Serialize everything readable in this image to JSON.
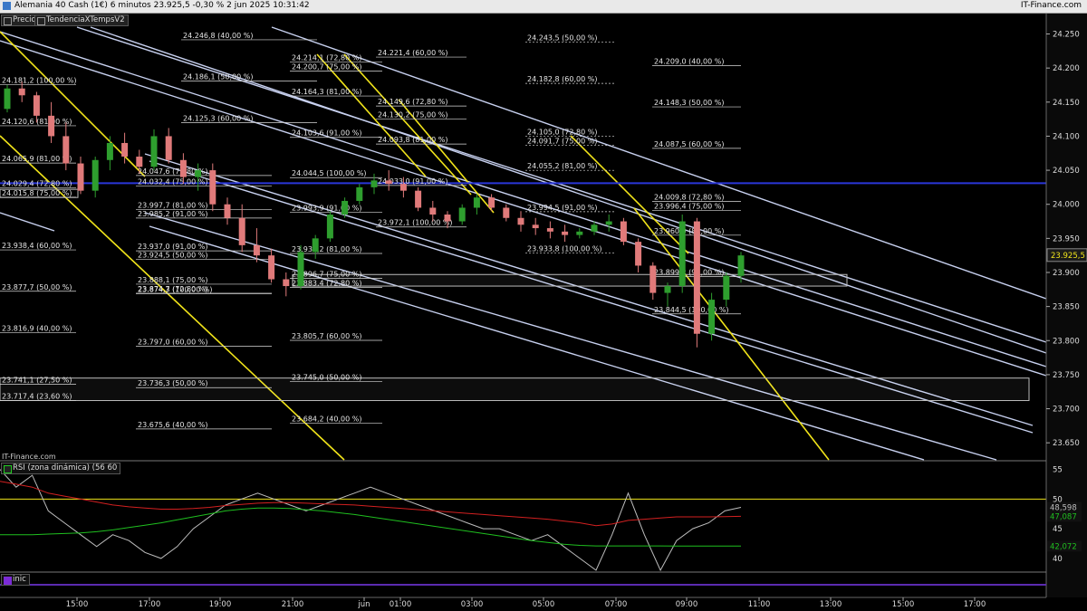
{
  "window": {
    "title": "Alemania 40 Cash (1€) 6 minutos 23.925,5 -0,30 % 2 jun 2025 10:31:42",
    "brand": "IT-Finance.com"
  },
  "legend": {
    "items": [
      "Precio",
      "TendenciaXTempsV2"
    ]
  },
  "watermark": "IT-Finance.com",
  "rsi_legend": "RSI (zona dinámica) (56 60",
  "inic_legend": "inic",
  "colors": {
    "background": "#000000",
    "candle_up": "#2e9e2e",
    "candle_down": "#e07a7a",
    "trend_white": "#c7d0ef",
    "trend_yellow": "#f1e41a",
    "horizontal_blue": "#2a36d9",
    "rsi_line": "#bdbdbd",
    "rsi_red": "#d32020",
    "rsi_green": "#1fbf1f"
  },
  "chart_data": [
    {
      "type": "candlestick",
      "title": "Alemania 40 Cash (1€) 6 minutos",
      "y_ticks": [
        "24.250",
        "24.200",
        "24.150",
        "24.100",
        "24.050",
        "24.000",
        "23.950",
        "23.900",
        "23.850",
        "23.800",
        "23.750",
        "23.700",
        "23.650"
      ],
      "x_ticks": [
        "15:00",
        "17:00",
        "19:00",
        "21:00",
        "jun",
        "01:00",
        "03:00",
        "05:00",
        "07:00",
        "09:00",
        "11:00",
        "13:00",
        "15:00",
        "17:00"
      ],
      "ylim": [
        23625,
        24260
      ],
      "last_price_label": "23.925,5",
      "horizontal_line": 24031,
      "fib_levels": [
        {
          "label": "24.246,8 (40,00 %)",
          "value": 24246.8
        },
        {
          "label": "24.186,1 (50,00 %)",
          "value": 24186.1
        },
        {
          "label": "24.125,3 (60,00 %)",
          "value": 24125.3
        },
        {
          "label": "24.047,6 (72,80 %)",
          "value": 24047.6
        },
        {
          "label": "24.032,4 (75,00 %)",
          "value": 24032.4
        },
        {
          "label": "23.997,7 (81,00 %)",
          "value": 23997.7
        },
        {
          "label": "23.985,2 (91,00 %)",
          "value": 23985.2
        },
        {
          "label": "23.937,0 (91,00 %)",
          "value": 23937.0
        },
        {
          "label": "23.924,5 (50,00 %)",
          "value": 23924.5
        },
        {
          "label": "23.888,1 (75,00 %)",
          "value": 23888.1
        },
        {
          "label": "23.874,7 (72,80 %)",
          "value": 23874.7
        },
        {
          "label": "23.874,3 (100,00 %)",
          "value": 23874.3
        },
        {
          "label": "23.797,0 (60,00 %)",
          "value": 23797.0
        },
        {
          "label": "23.736,3 (50,00 %)",
          "value": 23736.3
        },
        {
          "label": "23.675,6 (40,00 %)",
          "value": 23675.6
        },
        {
          "label": "24.181,2 (100,00 %)",
          "value": 24181.2
        },
        {
          "label": "24.120,6 (81,00 %)",
          "value": 24120.6
        },
        {
          "label": "24.065,9 (81,00 %)",
          "value": 24065.9
        },
        {
          "label": "24.029,4 (72,80 %)",
          "value": 24029.4
        },
        {
          "label": "24.015,8 (75,00 %)",
          "value": 24015.8
        },
        {
          "label": "23.938,4 (60,00 %)",
          "value": 23938.4
        },
        {
          "label": "23.877,7 (50,00 %)",
          "value": 23877.7
        },
        {
          "label": "23.816,9 (40,00 %)",
          "value": 23816.9
        },
        {
          "label": "23.741,1 (27,50 %)",
          "value": 23741.1
        },
        {
          "label": "23.717,4 (23,60 %)",
          "value": 23717.4
        },
        {
          "label": "24.214,1 (72,80 %)",
          "value": 24214.1
        },
        {
          "label": "24.200,7 (75,00 %)",
          "value": 24200.7
        },
        {
          "label": "24.164,3 (81,00 %)",
          "value": 24164.3
        },
        {
          "label": "24.103,6 (91,00 %)",
          "value": 24103.6
        },
        {
          "label": "24.044,5 (100,00 %)",
          "value": 24044.5
        },
        {
          "label": "23.993,9 (91,00 %)",
          "value": 23993.9
        },
        {
          "label": "23.933,2 (81,00 %)",
          "value": 23933.2
        },
        {
          "label": "23.896,7 (75,00 %)",
          "value": 23896.7
        },
        {
          "label": "23.883,4 (72,80 %)",
          "value": 23883.4
        },
        {
          "label": "23.805,7 (60,00 %)",
          "value": 23805.7
        },
        {
          "label": "23.745,0 (50,00 %)",
          "value": 23745.0
        },
        {
          "label": "23.684,2 (40,00 %)",
          "value": 23684.2
        },
        {
          "label": "24.221,4 (60,00 %)",
          "value": 24221.4
        },
        {
          "label": "24.149,6 (72,80 %)",
          "value": 24149.6
        },
        {
          "label": "24.130,2 (75,00 %)",
          "value": 24130.2
        },
        {
          "label": "24.093,8 (81,00 %)",
          "value": 24093.8
        },
        {
          "label": "24.033,0 (91,00 %)",
          "value": 24033.0
        },
        {
          "label": "23.972,1 (100,00 %)",
          "value": 23972.1
        },
        {
          "label": "24.243,5 (50,00 %)",
          "value": 24243.5
        },
        {
          "label": "24.182,8 (60,00 %)",
          "value": 24182.8
        },
        {
          "label": "24.105,0 (72,80 %)",
          "value": 24105.0
        },
        {
          "label": "24.091,7 (75,00 %)",
          "value": 24091.7
        },
        {
          "label": "24.055,2 (81,00 %)",
          "value": 24055.2
        },
        {
          "label": "23.994,5 (91,00 %)",
          "value": 23994.5
        },
        {
          "label": "23.933,8 (100,00 %)",
          "value": 23933.8
        },
        {
          "label": "24.209,0 (40,00 %)",
          "value": 24209.0
        },
        {
          "label": "24.148,3 (50,00 %)",
          "value": 24148.3
        },
        {
          "label": "24.087,5 (60,00 %)",
          "value": 24087.5
        },
        {
          "label": "24.009,8 (72,80 %)",
          "value": 24009.8
        },
        {
          "label": "23.996,4 (75,00 %)",
          "value": 23996.4
        },
        {
          "label": "23.960,0 (81,00 %)",
          "value": 23960.0
        },
        {
          "label": "23.899,2 (91,00 %)",
          "value": 23899.2
        },
        {
          "label": "23.844,5 (100,00 %)",
          "value": 23844.5
        }
      ],
      "candles": [
        [
          24140,
          24175,
          24135,
          24170
        ],
        [
          24170,
          24180,
          24150,
          24160
        ],
        [
          24160,
          24165,
          24120,
          24130
        ],
        [
          24130,
          24150,
          24090,
          24100
        ],
        [
          24100,
          24120,
          24050,
          24060
        ],
        [
          24060,
          24070,
          24015,
          24020
        ],
        [
          24020,
          24070,
          24010,
          24065
        ],
        [
          24065,
          24100,
          24050,
          24090
        ],
        [
          24090,
          24105,
          24060,
          24070
        ],
        [
          24070,
          24080,
          24045,
          24055
        ],
        [
          24055,
          24110,
          24050,
          24100
        ],
        [
          24100,
          24112,
          24060,
          24065
        ],
        [
          24065,
          24075,
          24030,
          24040
        ],
        [
          24040,
          24060,
          24020,
          24050
        ],
        [
          24050,
          24060,
          23990,
          24000
        ],
        [
          24000,
          24010,
          23970,
          23980
        ],
        [
          23980,
          24000,
          23930,
          23940
        ],
        [
          23940,
          23965,
          23915,
          23925
        ],
        [
          23925,
          23935,
          23885,
          23890
        ],
        [
          23890,
          23900,
          23865,
          23880
        ],
        [
          23880,
          23940,
          23875,
          23930
        ],
        [
          23930,
          23955,
          23920,
          23950
        ],
        [
          23950,
          23990,
          23945,
          23985
        ],
        [
          23985,
          24010,
          23980,
          24005
        ],
        [
          24005,
          24030,
          24000,
          24025
        ],
        [
          24025,
          24045,
          24015,
          24035
        ],
        [
          24035,
          24050,
          24020,
          24030
        ],
        [
          24030,
          24040,
          24010,
          24020
        ],
        [
          24020,
          24025,
          23990,
          23995
        ],
        [
          23995,
          24005,
          23975,
          23985
        ],
        [
          23985,
          23990,
          23965,
          23975
        ],
        [
          23975,
          24000,
          23970,
          23995
        ],
        [
          23995,
          24015,
          23985,
          24010
        ],
        [
          24010,
          24015,
          23990,
          23995
        ],
        [
          23995,
          24000,
          23975,
          23980
        ],
        [
          23980,
          23990,
          23960,
          23970
        ],
        [
          23970,
          23980,
          23955,
          23965
        ],
        [
          23965,
          23975,
          23950,
          23960
        ],
        [
          23960,
          23970,
          23945,
          23955
        ],
        [
          23955,
          23965,
          23950,
          23960
        ],
        [
          23960,
          23975,
          23955,
          23970
        ],
        [
          23970,
          23985,
          23960,
          23975
        ],
        [
          23975,
          23980,
          23940,
          23945
        ],
        [
          23945,
          23950,
          23900,
          23910
        ],
        [
          23910,
          23915,
          23860,
          23870
        ],
        [
          23870,
          23885,
          23850,
          23880
        ],
        [
          23880,
          23985,
          23870,
          23975
        ],
        [
          23975,
          23980,
          23790,
          23810
        ],
        [
          23810,
          23870,
          23800,
          23860
        ],
        [
          23860,
          23900,
          23850,
          23895
        ],
        [
          23895,
          23930,
          23885,
          23925
        ]
      ]
    },
    {
      "type": "line",
      "title": "RSI (zona dinámica) (56 60",
      "y_ticks": [
        "55",
        "50",
        "45",
        "40"
      ],
      "ylim": [
        38,
        56
      ],
      "reference_line": 50,
      "value_labels": [
        "48,598",
        "47,087",
        "42,072"
      ],
      "series": [
        {
          "name": "RSI",
          "values": [
            55,
            52,
            54,
            48,
            46,
            44,
            42,
            44,
            43,
            41,
            40,
            42,
            45,
            47,
            49,
            50,
            51,
            50,
            49,
            48,
            49,
            50,
            51,
            52,
            51,
            50,
            49,
            48,
            47,
            46,
            45,
            45,
            44,
            43,
            44,
            42,
            40,
            38,
            44,
            51,
            44,
            38,
            43,
            45,
            46,
            48,
            48.6
          ]
        },
        {
          "name": "upper",
          "values": [
            53,
            52.5,
            52,
            51,
            50.5,
            50,
            49.5,
            49,
            48.7,
            48.5,
            48.3,
            48.3,
            48.4,
            48.6,
            48.9,
            49.1,
            49.3,
            49.4,
            49.4,
            49.3,
            49.2,
            49.1,
            49.0,
            48.8,
            48.6,
            48.4,
            48.2,
            48.0,
            47.8,
            47.6,
            47.4,
            47.2,
            47.0,
            46.8,
            46.6,
            46.3,
            46.0,
            45.5,
            45.8,
            46.4,
            46.6,
            46.8,
            47.0,
            47.0,
            47.0,
            47.05,
            47.087
          ]
        },
        {
          "name": "lower",
          "values": [
            44,
            44,
            44,
            44.1,
            44.2,
            44.3,
            44.5,
            44.8,
            45.2,
            45.6,
            46.0,
            46.5,
            47.0,
            47.5,
            48.0,
            48.3,
            48.5,
            48.5,
            48.4,
            48.2,
            48.0,
            47.7,
            47.4,
            47.0,
            46.6,
            46.2,
            45.8,
            45.4,
            45.0,
            44.6,
            44.2,
            43.8,
            43.4,
            43.0,
            42.7,
            42.4,
            42.2,
            42.1,
            42.1,
            42.1,
            42.1,
            42.1,
            42.08,
            42.07,
            42.07,
            42.072,
            42.072
          ]
        }
      ]
    }
  ]
}
